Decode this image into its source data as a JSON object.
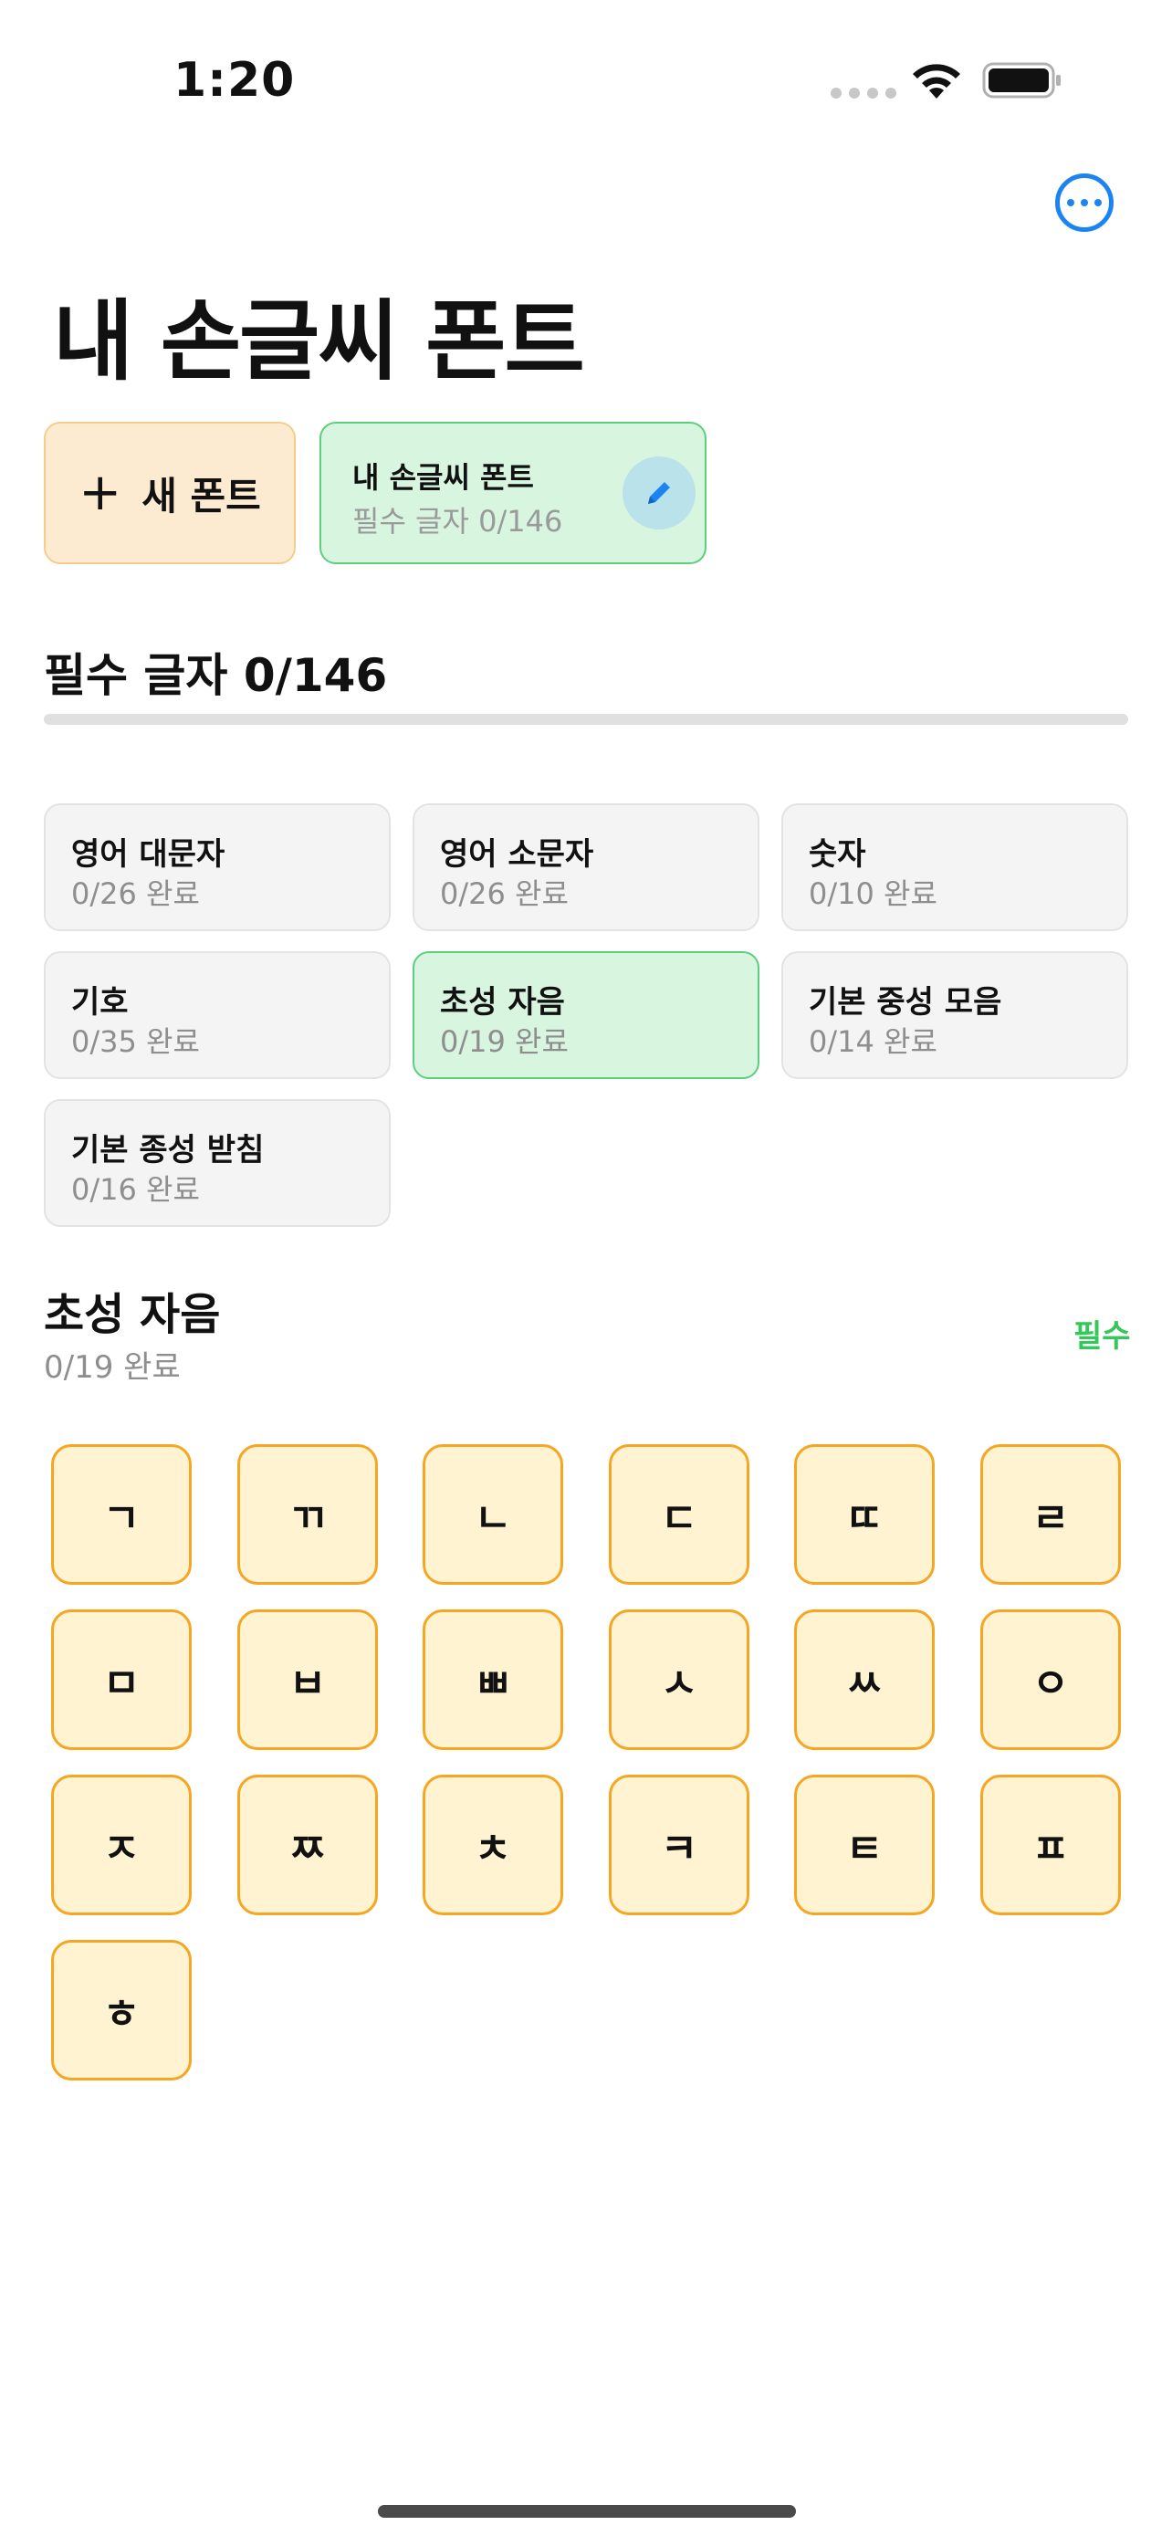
{
  "status_bar": {
    "time": "1:20"
  },
  "header": {
    "title": "내 손글씨 폰트",
    "more_icon": "ellipsis-circle-icon"
  },
  "font_chips": {
    "new_font_label": "새 폰트",
    "current": {
      "name": "내 손글씨 폰트",
      "progress": "필수 글자 0/146",
      "edit_icon": "pencil-icon"
    }
  },
  "required_section": {
    "title": "필수 글자 0/146",
    "progress_fraction": 0
  },
  "categories": [
    {
      "name": "영어 대문자",
      "progress": "0/26 완료",
      "active": false
    },
    {
      "name": "영어 소문자",
      "progress": "0/26 완료",
      "active": false
    },
    {
      "name": "숫자",
      "progress": "0/10 완료",
      "active": false
    },
    {
      "name": "기호",
      "progress": "0/35 완료",
      "active": false
    },
    {
      "name": "초성 자음",
      "progress": "0/19 완료",
      "active": true
    },
    {
      "name": "기본 중성 모음",
      "progress": "0/14 완료",
      "active": false
    },
    {
      "name": "기본 종성 받침",
      "progress": "0/16 완료",
      "active": false
    }
  ],
  "group": {
    "title": "초성 자음",
    "subtitle": "0/19 완료",
    "tag": "필수"
  },
  "letters": [
    "ㄱ",
    "ㄲ",
    "ㄴ",
    "ㄷ",
    "ㄸ",
    "ㄹ",
    "ㅁ",
    "ㅂ",
    "ㅃ",
    "ㅅ",
    "ㅆ",
    "ㅇ",
    "ㅈ",
    "ㅉ",
    "ㅊ",
    "ㅋ",
    "ㅌ",
    "ㅍ",
    "ㅎ"
  ],
  "colors": {
    "accent_blue": "#1c84f2",
    "accent_green": "#34c759",
    "tile_fill": "#fff3d1",
    "tile_border": "#f5a623"
  }
}
